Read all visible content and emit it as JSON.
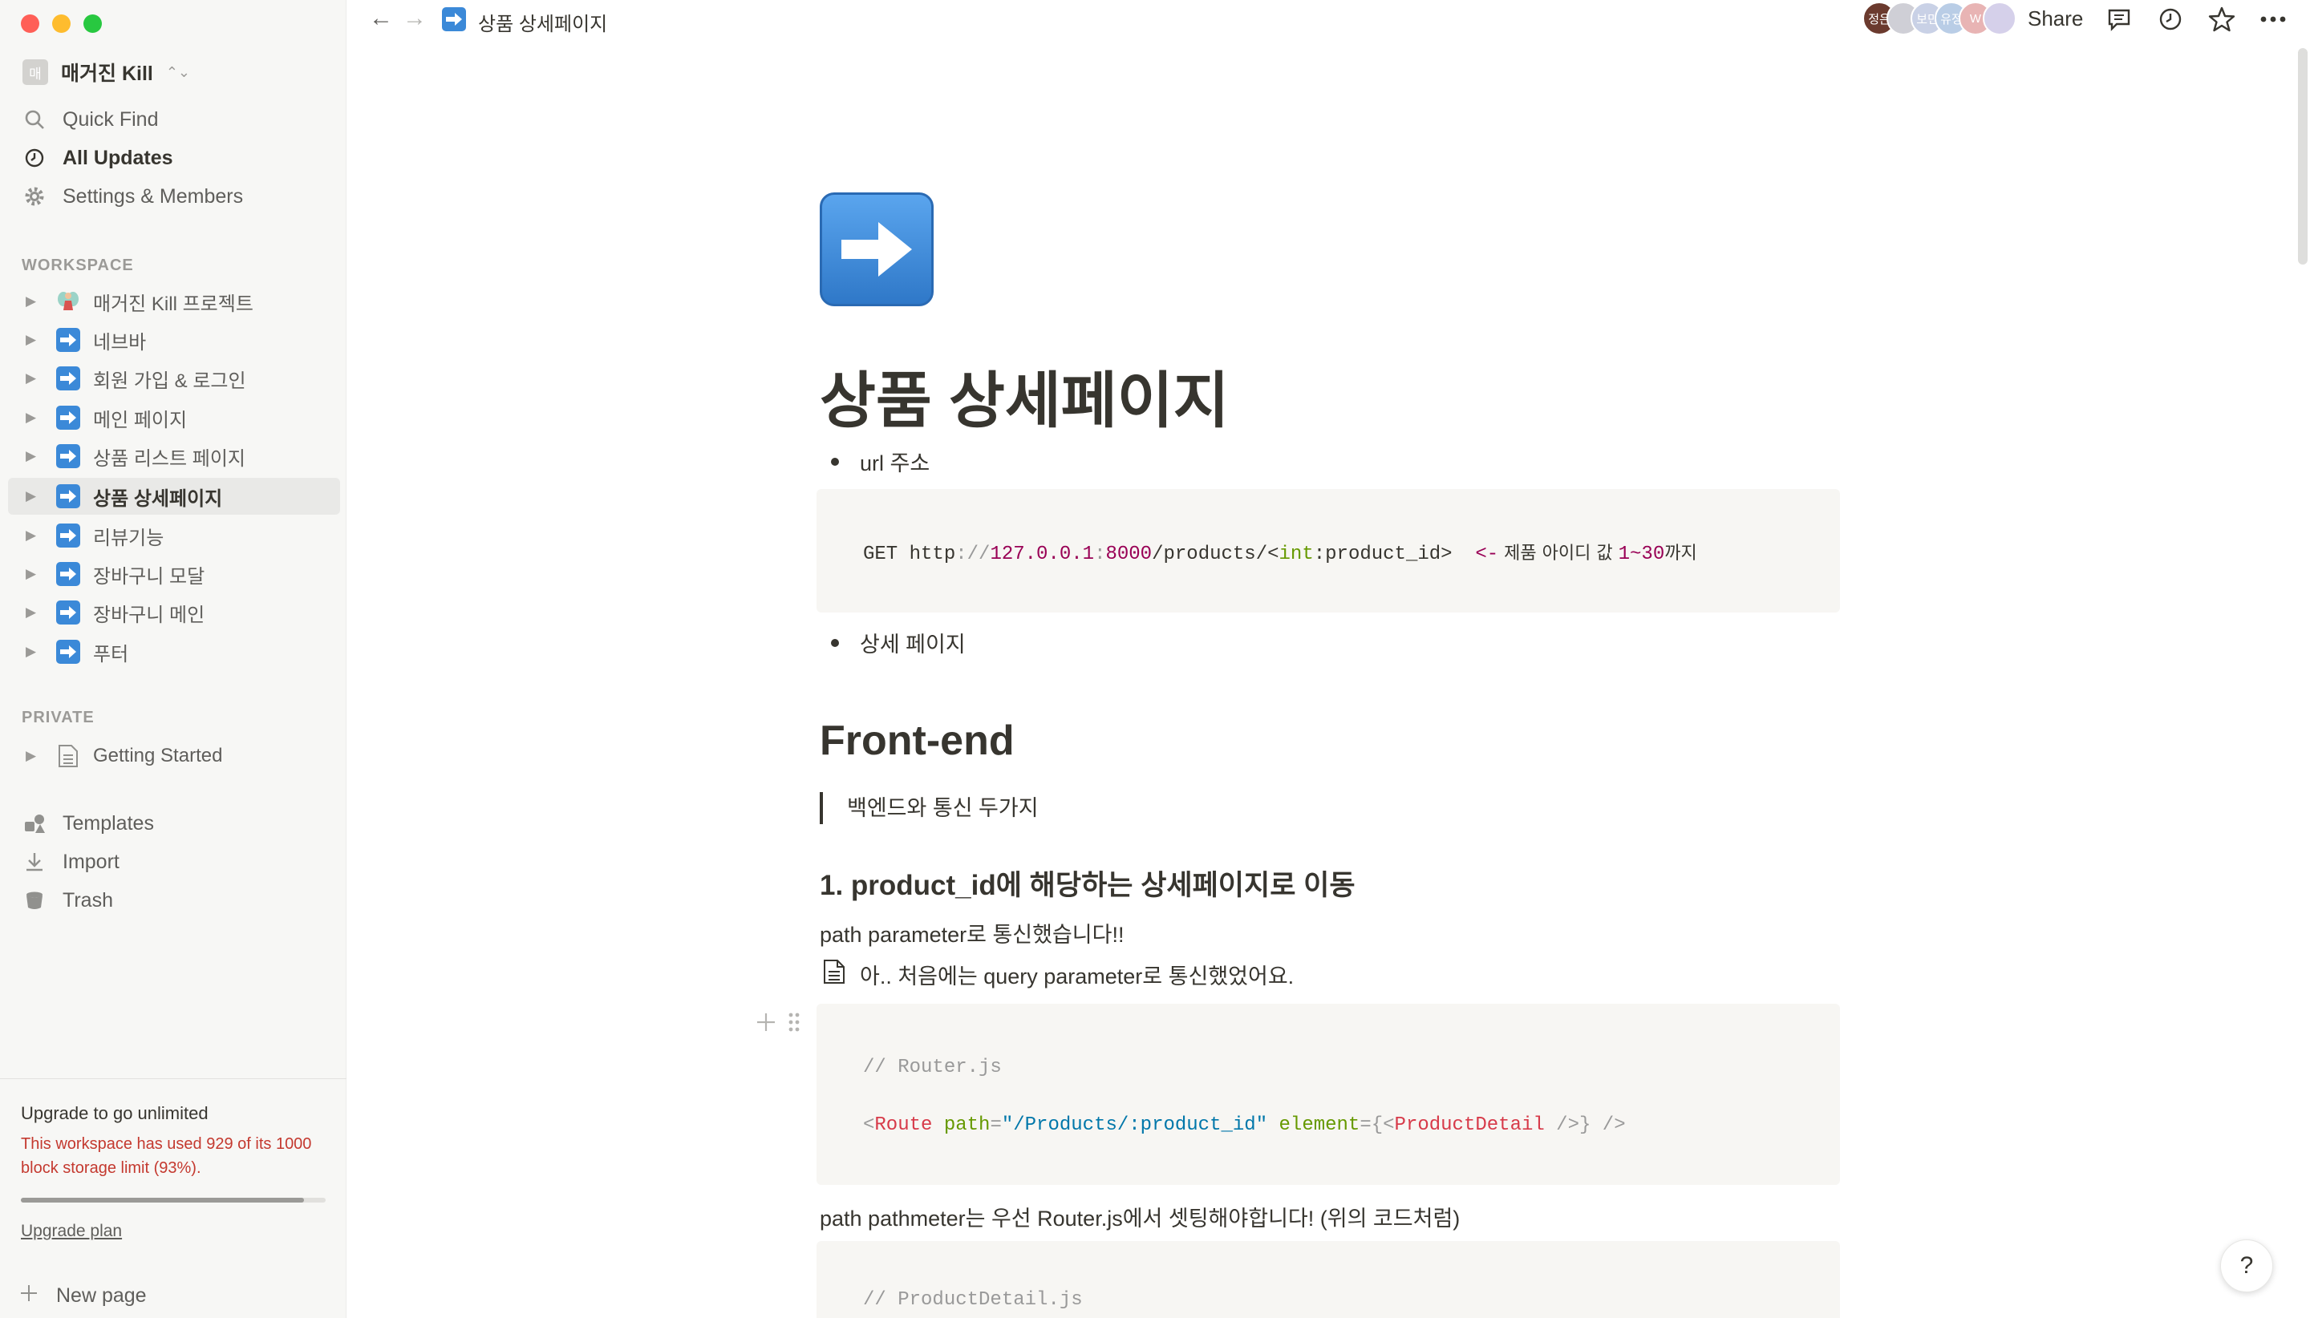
{
  "sidebar": {
    "workspace": {
      "initial": "매",
      "name": "매거진 Kill"
    },
    "nav": [
      {
        "label": "Quick Find"
      },
      {
        "label": "All Updates"
      },
      {
        "label": "Settings & Members"
      }
    ],
    "workspace_label": "WORKSPACE",
    "pages": [
      {
        "label": "매거진 Kill 프로젝트",
        "icon": "fairy-icon"
      },
      {
        "label": "네브바",
        "icon": "right-arrow-emoji-icon"
      },
      {
        "label": "회원 가입 & 로그인",
        "icon": "right-arrow-emoji-icon"
      },
      {
        "label": "메인 페이지",
        "icon": "right-arrow-emoji-icon"
      },
      {
        "label": "상품 리스트 페이지",
        "icon": "right-arrow-emoji-icon"
      },
      {
        "label": "상품 상세페이지",
        "icon": "right-arrow-emoji-icon",
        "active": true
      },
      {
        "label": "리뷰기능",
        "icon": "right-arrow-emoji-icon"
      },
      {
        "label": "장바구니 모달",
        "icon": "right-arrow-emoji-icon"
      },
      {
        "label": "장바구니 메인",
        "icon": "right-arrow-emoji-icon"
      },
      {
        "label": "푸터",
        "icon": "right-arrow-emoji-icon"
      }
    ],
    "private_label": "PRIVATE",
    "private_pages": [
      {
        "label": "Getting Started",
        "icon": "document-icon"
      }
    ],
    "tools": [
      {
        "label": "Templates"
      },
      {
        "label": "Import"
      },
      {
        "label": "Trash"
      }
    ],
    "upgrade": {
      "title": "Upgrade to go unlimited",
      "warning": "This workspace has used 929 of its 1000 block storage limit (93%).",
      "usage_fraction": 0.93,
      "link": "Upgrade plan"
    },
    "new_page": "New page"
  },
  "topbar": {
    "breadcrumb": "상품 상세페이지",
    "avatars": [
      {
        "text": "정은",
        "color": "#6b3a2e"
      },
      {
        "text": "",
        "color": "#cfcfd6"
      },
      {
        "text": "보민",
        "color": "#c9d1e6"
      },
      {
        "text": "유정",
        "color": "#b9cde6"
      },
      {
        "text": "W",
        "color": "#e8b4b4"
      },
      {
        "text": "",
        "color": "#d5d0ea"
      }
    ],
    "share": "Share"
  },
  "page": {
    "title": "상품 상세페이지",
    "bullet1": "url 주소",
    "code1": {
      "method": "GET ",
      "scheme": "http",
      "sep": "://",
      "host": "127.0.0.1",
      "colon": ":",
      "port": "8000",
      "path": "/products/<",
      "param_type": "int",
      "param_colon": ":",
      "param_name": "product_id",
      "close": ">",
      "arrow": "  <-",
      "comment_a": " 제품 아이디 값 ",
      "range": "1~30",
      "comment_b": "까지"
    },
    "bullet2": "상세 페이지",
    "h1": "Front-end",
    "quote": "백엔드와 통신 두가지",
    "h3": "1. product_id에 해당하는 상세페이지로 이동",
    "para1": "path parameter로 통신했습니다!!",
    "link1": "아.. 처음에는 query parameter로 통신했었어요.",
    "code2": {
      "comment": "// Router.js",
      "lt": "<",
      "tag": "Route",
      "attr1": " path",
      "eq1": "=",
      "val1": "\"/Products/:product_id\"",
      "attr2": " element",
      "eq2": "=",
      "brace_open": "{<",
      "comp": "ProductDetail",
      "self_close": " />}",
      "end": " />"
    },
    "para2": "path pathmeter는 우선 Router.js에서 셋팅해야합니다! (위의 코드처럼)",
    "code3": {
      "comment": "// ProductDetail.js"
    }
  },
  "help": "?"
}
